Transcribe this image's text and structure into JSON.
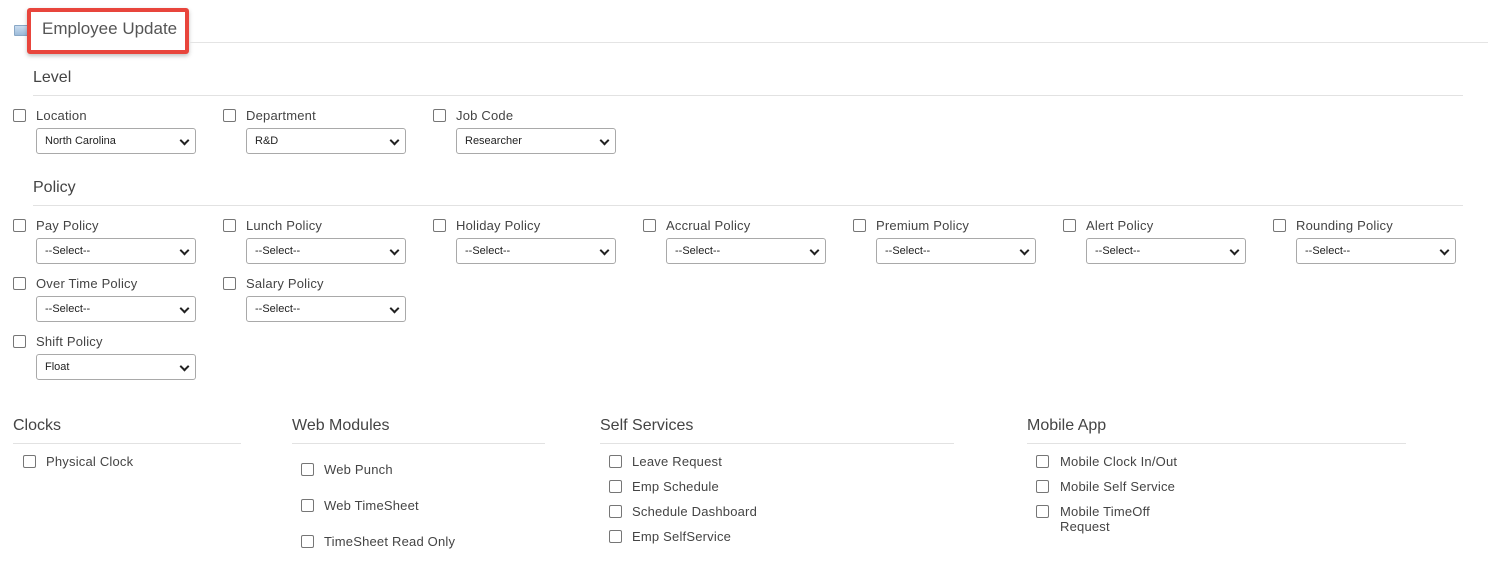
{
  "header": {
    "title": "Employee Update"
  },
  "level": {
    "title": "Level",
    "fields": [
      {
        "label": "Location",
        "value": "North Carolina"
      },
      {
        "label": "Department",
        "value": "R&D"
      },
      {
        "label": "Job Code",
        "value": "Researcher"
      }
    ]
  },
  "policy": {
    "title": "Policy",
    "fields": [
      {
        "label": "Pay Policy",
        "value": "--Select--"
      },
      {
        "label": "Lunch Policy",
        "value": "--Select--"
      },
      {
        "label": "Holiday Policy",
        "value": "--Select--"
      },
      {
        "label": "Accrual Policy",
        "value": "--Select--"
      },
      {
        "label": "Premium Policy",
        "value": "--Select--"
      },
      {
        "label": "Alert Policy",
        "value": "--Select--"
      },
      {
        "label": "Rounding Policy",
        "value": "--Select--"
      },
      {
        "label": "Over Time Policy",
        "value": "--Select--"
      },
      {
        "label": "Salary Policy",
        "value": "--Select--"
      },
      {
        "label": "Shift Policy",
        "value": "Float"
      }
    ]
  },
  "clocks": {
    "title": "Clocks",
    "items": [
      "Physical Clock"
    ]
  },
  "web_modules": {
    "title": "Web Modules",
    "items": [
      "Web Punch",
      "Web TimeSheet",
      "TimeSheet Read Only"
    ]
  },
  "self_services": {
    "title": "Self Services",
    "items": [
      "Leave Request",
      "Emp Schedule",
      "Schedule Dashboard",
      "Emp SelfService"
    ]
  },
  "mobile_app": {
    "title": "Mobile App",
    "items": [
      "Mobile Clock In/Out",
      "Mobile Self Service",
      "Mobile TimeOff Request"
    ]
  }
}
